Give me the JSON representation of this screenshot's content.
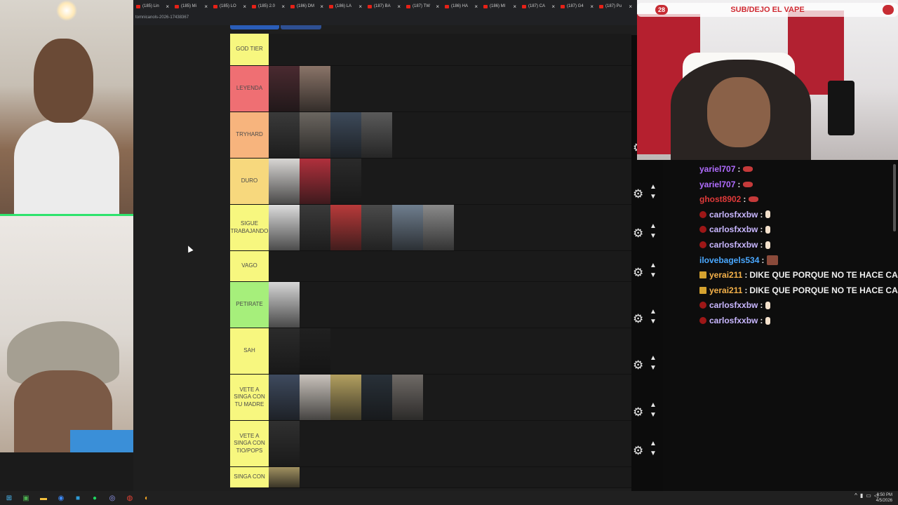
{
  "browser": {
    "url": "tomnicanols-2026-17438367",
    "tabs": [
      "(185) Lin",
      "(185) Mi",
      "(185) LO",
      "(185) 2.0",
      "(186) DM",
      "(186) LA",
      "(187) BA",
      "(187) TW",
      "(186) HA",
      "(186) MI",
      "(187) CA",
      "(187) G4",
      "(187) Pu"
    ]
  },
  "tiers": [
    {
      "label": "GOD TIER",
      "color": "#f7f77f",
      "items": []
    },
    {
      "label": "LEYENDA",
      "color": "#ef6f73",
      "items": [
        "#4a2a30",
        "#8a7468"
      ]
    },
    {
      "label": "TRYHARD",
      "color": "#f7b47d",
      "items": [
        "#3a3a3a",
        "#6b6660",
        "#3d4a5a",
        "#5a5a5a"
      ]
    },
    {
      "label": "DURO",
      "color": "#f7d87d",
      "items": [
        "#d8d6d4",
        "#b0303c",
        "#2a2a2a"
      ]
    },
    {
      "label": "SIGUE TRABAJANDO",
      "color": "#f7f77f",
      "items": [
        "#dcdcdc",
        "#3a3a3a",
        "#b83a3a",
        "#4a4a4a",
        "#6f7e8e",
        "#8a8a8a"
      ]
    },
    {
      "label": "VAGO",
      "color": "#f7f77f",
      "items": []
    },
    {
      "label": "PETIRATE",
      "color": "#a6ef7b",
      "items": [
        "#d6d6d6"
      ]
    },
    {
      "label": "SAH",
      "color": "#f7f77f",
      "items": [
        "#2b2b2b",
        "#202020"
      ]
    },
    {
      "label": "VETE A SINGA CON TU MADRE",
      "color": "#f7f77f",
      "items": [
        "#3e4a5e",
        "#c9c3bc",
        "#b3a060",
        "#283038",
        "#6f6a66"
      ]
    },
    {
      "label": "VETE A SINGA CON TIO/POPS",
      "color": "#f7f77f",
      "items": [
        "#303030"
      ]
    },
    {
      "label": "SINGA CON",
      "color": "#f7f77f",
      "items": [
        "#a09060"
      ]
    }
  ],
  "stream": {
    "banner_count": "28",
    "banner_text": "SUB/DEJO EL VAPE"
  },
  "chat": [
    {
      "user": "yariel707",
      "color": "#b06cff",
      "badge": "",
      "message": "",
      "emote": "lips"
    },
    {
      "user": "yariel707",
      "color": "#b06cff",
      "badge": "",
      "message": "",
      "emote": "lips"
    },
    {
      "user": "ghost8902",
      "color": "#e03a3a",
      "badge": "",
      "message": "",
      "emote": "lips"
    },
    {
      "user": "carlosfxxbw",
      "color": "#c9b7ff",
      "badge": "red",
      "message": "",
      "emote": "hand"
    },
    {
      "user": "carlosfxxbw",
      "color": "#c9b7ff",
      "badge": "red",
      "message": "",
      "emote": "hand"
    },
    {
      "user": "carlosfxxbw",
      "color": "#c9b7ff",
      "badge": "red",
      "message": "",
      "emote": "hand"
    },
    {
      "user": "ilovebagels534",
      "color": "#4aa8ff",
      "badge": "",
      "message": "",
      "emote": "bagel"
    },
    {
      "user": "yerai211",
      "color": "#f5b24a",
      "badge": "gold",
      "message": "DIKE QUE PORQUE NO TE HACE CASO T",
      "emote": ""
    },
    {
      "user": "yerai211",
      "color": "#f5b24a",
      "badge": "gold",
      "message": "DIKE QUE PORQUE NO TE HACE CASO T",
      "emote": ""
    },
    {
      "user": "carlosfxxbw",
      "color": "#c9b7ff",
      "badge": "red",
      "message": "",
      "emote": "hand"
    },
    {
      "user": "carlosfxxbw",
      "color": "#c9b7ff",
      "badge": "red",
      "message": "",
      "emote": "hand"
    }
  ],
  "taskbar": {
    "time": "8:50 PM",
    "date": "4/5/2026"
  }
}
